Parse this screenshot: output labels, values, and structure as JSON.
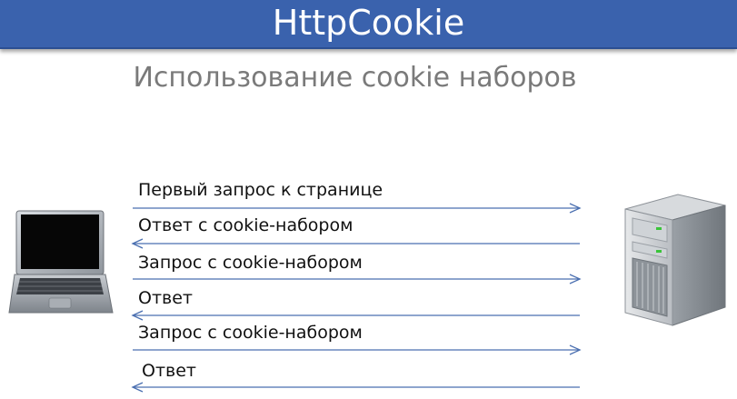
{
  "slide": {
    "title": "HttpCookie",
    "subtitle": "Использование cookie наборов"
  },
  "messages": [
    {
      "label": "Первый запрос к странице",
      "direction": "to-server"
    },
    {
      "label": "Ответ с cookie-набором",
      "direction": "to-client"
    },
    {
      "label": "Запрос с cookie-набором",
      "direction": "to-server"
    },
    {
      "label": "Ответ",
      "direction": "to-client"
    },
    {
      "label": "Запрос с cookie-набором",
      "direction": "to-server"
    },
    {
      "label": "Ответ",
      "direction": "to-client"
    }
  ],
  "nodes": {
    "client_icon": "laptop-icon",
    "server_icon": "server-tower-icon"
  },
  "colors": {
    "header": "#3a62ad",
    "arrow": "#4a6fb0",
    "subtitle": "#7a7a7a"
  }
}
